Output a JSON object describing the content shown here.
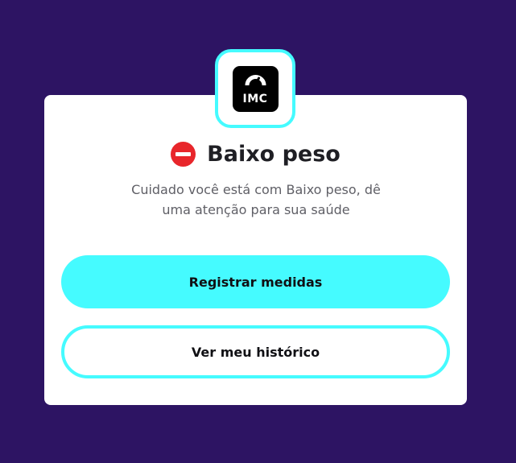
{
  "logo": {
    "text": "IMC",
    "icon": "gauge-icon",
    "accent_color": "#45fbff"
  },
  "status": {
    "icon": "no-entry-icon",
    "icon_color": "#e8262b",
    "title": "Baixo peso",
    "message": "Cuidado você está com Baixo peso, dê uma atenção para sua saúde"
  },
  "actions": {
    "primary_label": "Registrar medidas",
    "secondary_label": "Ver meu histórico"
  },
  "colors": {
    "background": "#2d1463",
    "card": "#ffffff",
    "accent": "#45fbff"
  }
}
